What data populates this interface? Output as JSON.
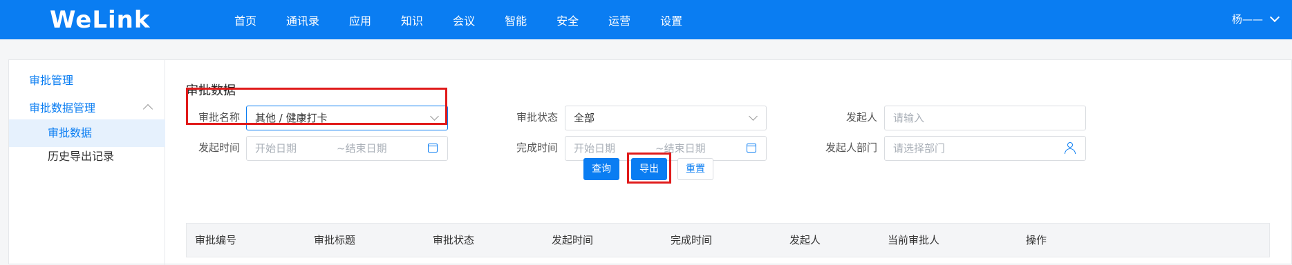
{
  "app": {
    "logo": "WeLink"
  },
  "nav": [
    "首页",
    "通讯录",
    "应用",
    "知识",
    "会议",
    "智能",
    "安全",
    "运营",
    "设置"
  ],
  "user": {
    "name": "杨——"
  },
  "sidebar": {
    "items": [
      {
        "label": "审批管理"
      },
      {
        "label": "审批数据管理"
      },
      {
        "label": "审批数据"
      },
      {
        "label": "历史导出记录"
      }
    ]
  },
  "content": {
    "title": "审批数据",
    "filters": {
      "approval_name": {
        "label": "审批名称",
        "value": "其他 / 健康打卡"
      },
      "approval_status": {
        "label": "审批状态",
        "value": "全部"
      },
      "initiator": {
        "label": "发起人",
        "placeholder": "请输入"
      },
      "start_time": {
        "label": "发起时间",
        "start_placeholder": "开始日期",
        "end_placeholder": "~结束日期"
      },
      "finish_time": {
        "label": "完成时间",
        "start_placeholder": "开始日期",
        "end_placeholder": "~结束日期"
      },
      "initiator_dept": {
        "label": "发起人部门",
        "placeholder": "请选择部门"
      }
    },
    "buttons": {
      "query": "查询",
      "export": "导出",
      "reset": "重置"
    },
    "table": {
      "columns": [
        "审批编号",
        "审批标题",
        "审批状态",
        "发起时间",
        "完成时间",
        "发起人",
        "当前审批人",
        "操作"
      ]
    }
  },
  "colors": {
    "brand": "#0a7df2",
    "highlight": "#e01a1a"
  }
}
